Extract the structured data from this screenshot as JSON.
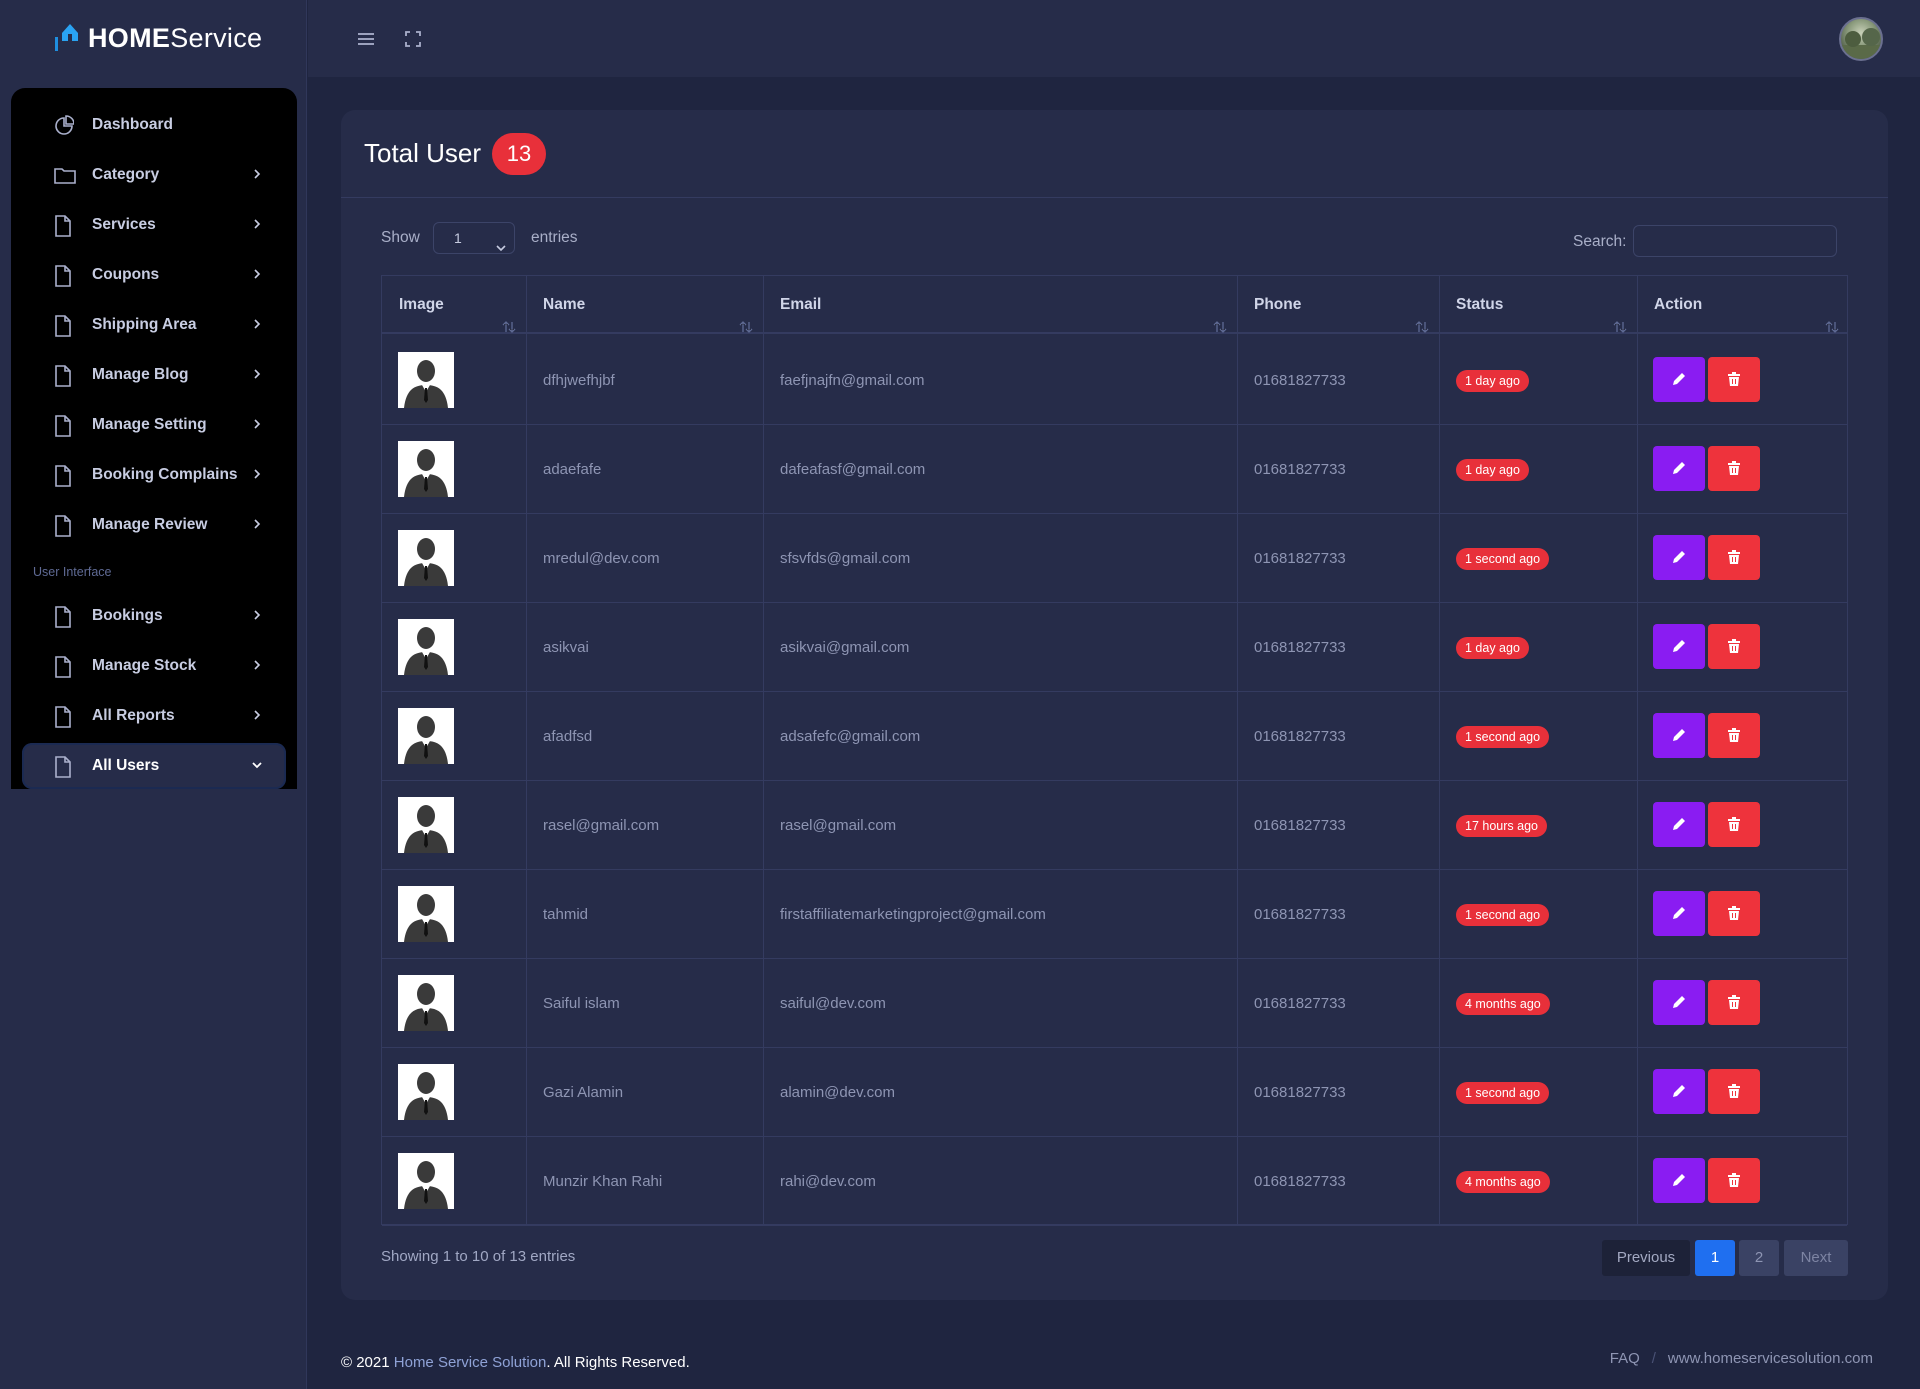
{
  "brand": {
    "bold": "HOME",
    "light": "Service"
  },
  "sidebar": {
    "items": [
      {
        "label": "Dashboard",
        "icon": "pie-chart-icon",
        "chevron": false
      },
      {
        "label": "Category",
        "icon": "folder-icon",
        "chevron": true
      },
      {
        "label": "Services",
        "icon": "file-icon",
        "chevron": true
      },
      {
        "label": "Coupons",
        "icon": "file-icon",
        "chevron": true
      },
      {
        "label": "Shipping Area",
        "icon": "file-icon",
        "chevron": true
      },
      {
        "label": "Manage Blog",
        "icon": "file-icon",
        "chevron": true
      },
      {
        "label": "Manage Setting",
        "icon": "file-icon",
        "chevron": true
      },
      {
        "label": "Booking Complains",
        "icon": "file-icon",
        "chevron": true
      },
      {
        "label": "Manage Review",
        "icon": "file-icon",
        "chevron": true
      }
    ],
    "section_label": "User Interface",
    "items2": [
      {
        "label": "Bookings",
        "icon": "file-icon",
        "chevron": true
      },
      {
        "label": "Manage Stock",
        "icon": "file-icon",
        "chevron": true
      },
      {
        "label": "All Reports",
        "icon": "file-icon",
        "chevron": true
      },
      {
        "label": "All Users",
        "icon": "file-icon",
        "chevron": true,
        "active": true
      }
    ]
  },
  "card": {
    "title": "Total User",
    "count": "13",
    "show_label": "Show",
    "entries_value": "1",
    "entries_label": "entries",
    "search_label": "Search:",
    "search_value": ""
  },
  "table": {
    "columns": [
      "Image",
      "Name",
      "Email",
      "Phone",
      "Status",
      "Action"
    ],
    "rows": [
      {
        "name": "dfhjwefhjbf",
        "email": "faefjnajfn@gmail.com",
        "phone": "01681827733",
        "status": "1 day ago"
      },
      {
        "name": "adaefafe",
        "email": "dafeafasf@gmail.com",
        "phone": "01681827733",
        "status": "1 day ago"
      },
      {
        "name": "mredul@dev.com",
        "email": "sfsvfds@gmail.com",
        "phone": "01681827733",
        "status": "1 second ago"
      },
      {
        "name": "asikvai",
        "email": "asikvai@gmail.com",
        "phone": "01681827733",
        "status": "1 day ago"
      },
      {
        "name": "afadfsd",
        "email": "adsafefc@gmail.com",
        "phone": "01681827733",
        "status": "1 second ago"
      },
      {
        "name": "rasel@gmail.com",
        "email": "rasel@gmail.com",
        "phone": "01681827733",
        "status": "17 hours ago"
      },
      {
        "name": "tahmid",
        "email": "firstaffiliatemarketingproject@gmail.com",
        "phone": "01681827733",
        "status": "1 second ago"
      },
      {
        "name": "Saiful islam",
        "email": "saiful@dev.com",
        "phone": "01681827733",
        "status": "4 months ago"
      },
      {
        "name": "Gazi Alamin",
        "email": "alamin@dev.com",
        "phone": "01681827733",
        "status": "1 second ago"
      },
      {
        "name": "Munzir Khan Rahi",
        "email": "rahi@dev.com",
        "phone": "01681827733",
        "status": "4 months ago"
      }
    ]
  },
  "pagination": {
    "info": "Showing 1 to 10 of 13 entries",
    "prev": "Previous",
    "pages": [
      "1",
      "2"
    ],
    "current": "1",
    "next": "Next"
  },
  "footer": {
    "copyright_prefix": "© 2021",
    "company": "Home Service Solution",
    "rights": ". All Rights Reserved.",
    "links": [
      "FAQ",
      "www.homeservicesolution.com"
    ]
  },
  "colors": {
    "accent_blue": "#1f6ff0",
    "danger": "#e8303a",
    "edit_purple": "#8a1cf2",
    "bg": "#1f2540",
    "panel": "#262c49"
  }
}
